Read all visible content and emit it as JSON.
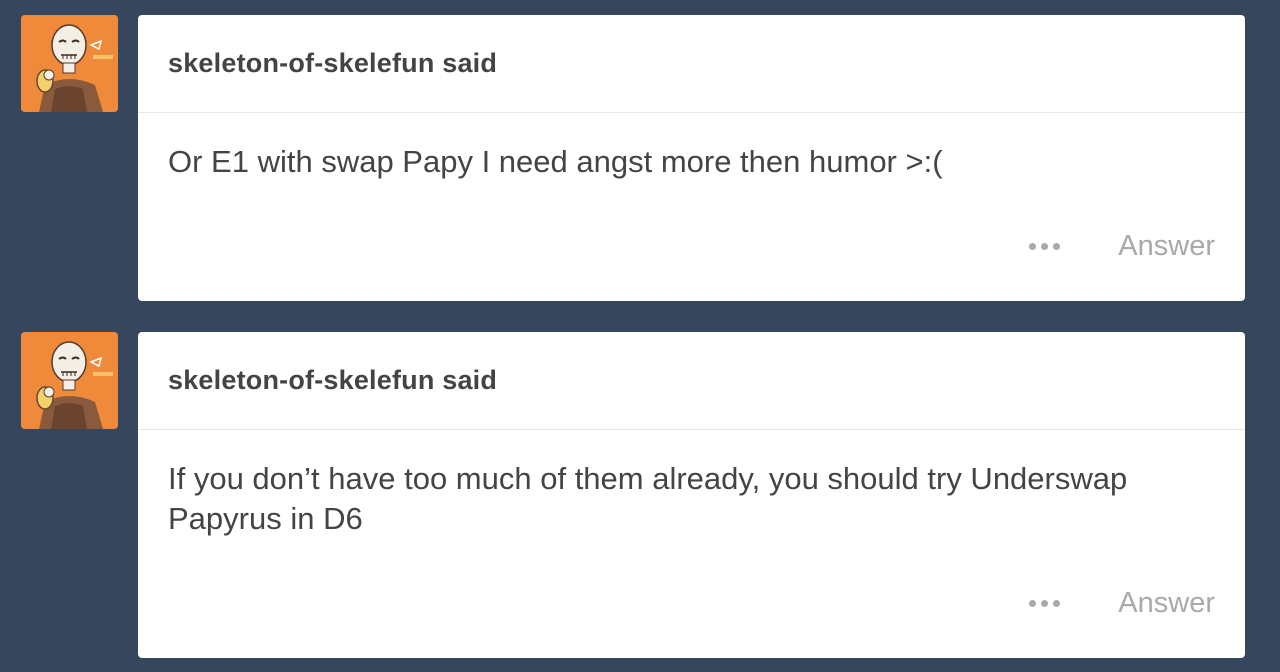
{
  "colors": {
    "background": "#36465d",
    "card": "#ffffff",
    "text": "#444444",
    "muted": "#a9a9a9",
    "avatar_bg": "#ee8a3a"
  },
  "messages": [
    {
      "asker": "skeleton-of-skelefun said",
      "body": "Or E1 with swap Papy I need angst more then humor >:(",
      "answer_label": "Answer",
      "more_icon": "ellipsis-icon"
    },
    {
      "asker": "skeleton-of-skelefun said",
      "body": "If you don’t have too much of them already, you should try Underswap Papyrus in D6",
      "answer_label": "Answer",
      "more_icon": "ellipsis-icon"
    }
  ]
}
